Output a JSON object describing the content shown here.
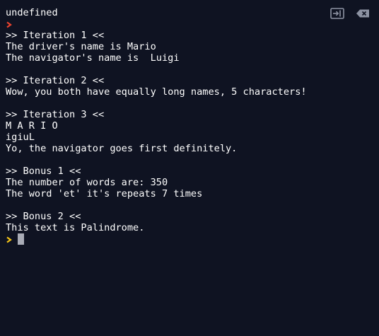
{
  "console": {
    "lines": [
      "undefined",
      "",
      ">> Iteration 1 <<",
      "The driver's name is Mario",
      "The navigator's name is  Luigi",
      "",
      ">> Iteration 2 <<",
      "Wow, you both have equally long names, 5 characters!",
      "",
      ">> Iteration 3 <<",
      "M A R I O",
      "igiuL",
      "Yo, the navigator goes first definitely.",
      "",
      ">> Bonus 1 <<",
      "The number of words are: 350",
      "The word 'et' it's repeats 7 times",
      "",
      ">> Bonus 2 <<",
      "This text is Palindrome."
    ]
  },
  "toolbar": {
    "icons": [
      "collapse-panel-icon",
      "clear-console-icon"
    ]
  },
  "colors": {
    "background": "#0f1322",
    "text": "#ffffff",
    "old_prompt": "#e8432f",
    "active_prompt": "#f5c518",
    "cursor": "#a9acb6",
    "toolbar_icon": "#8d93a3"
  }
}
